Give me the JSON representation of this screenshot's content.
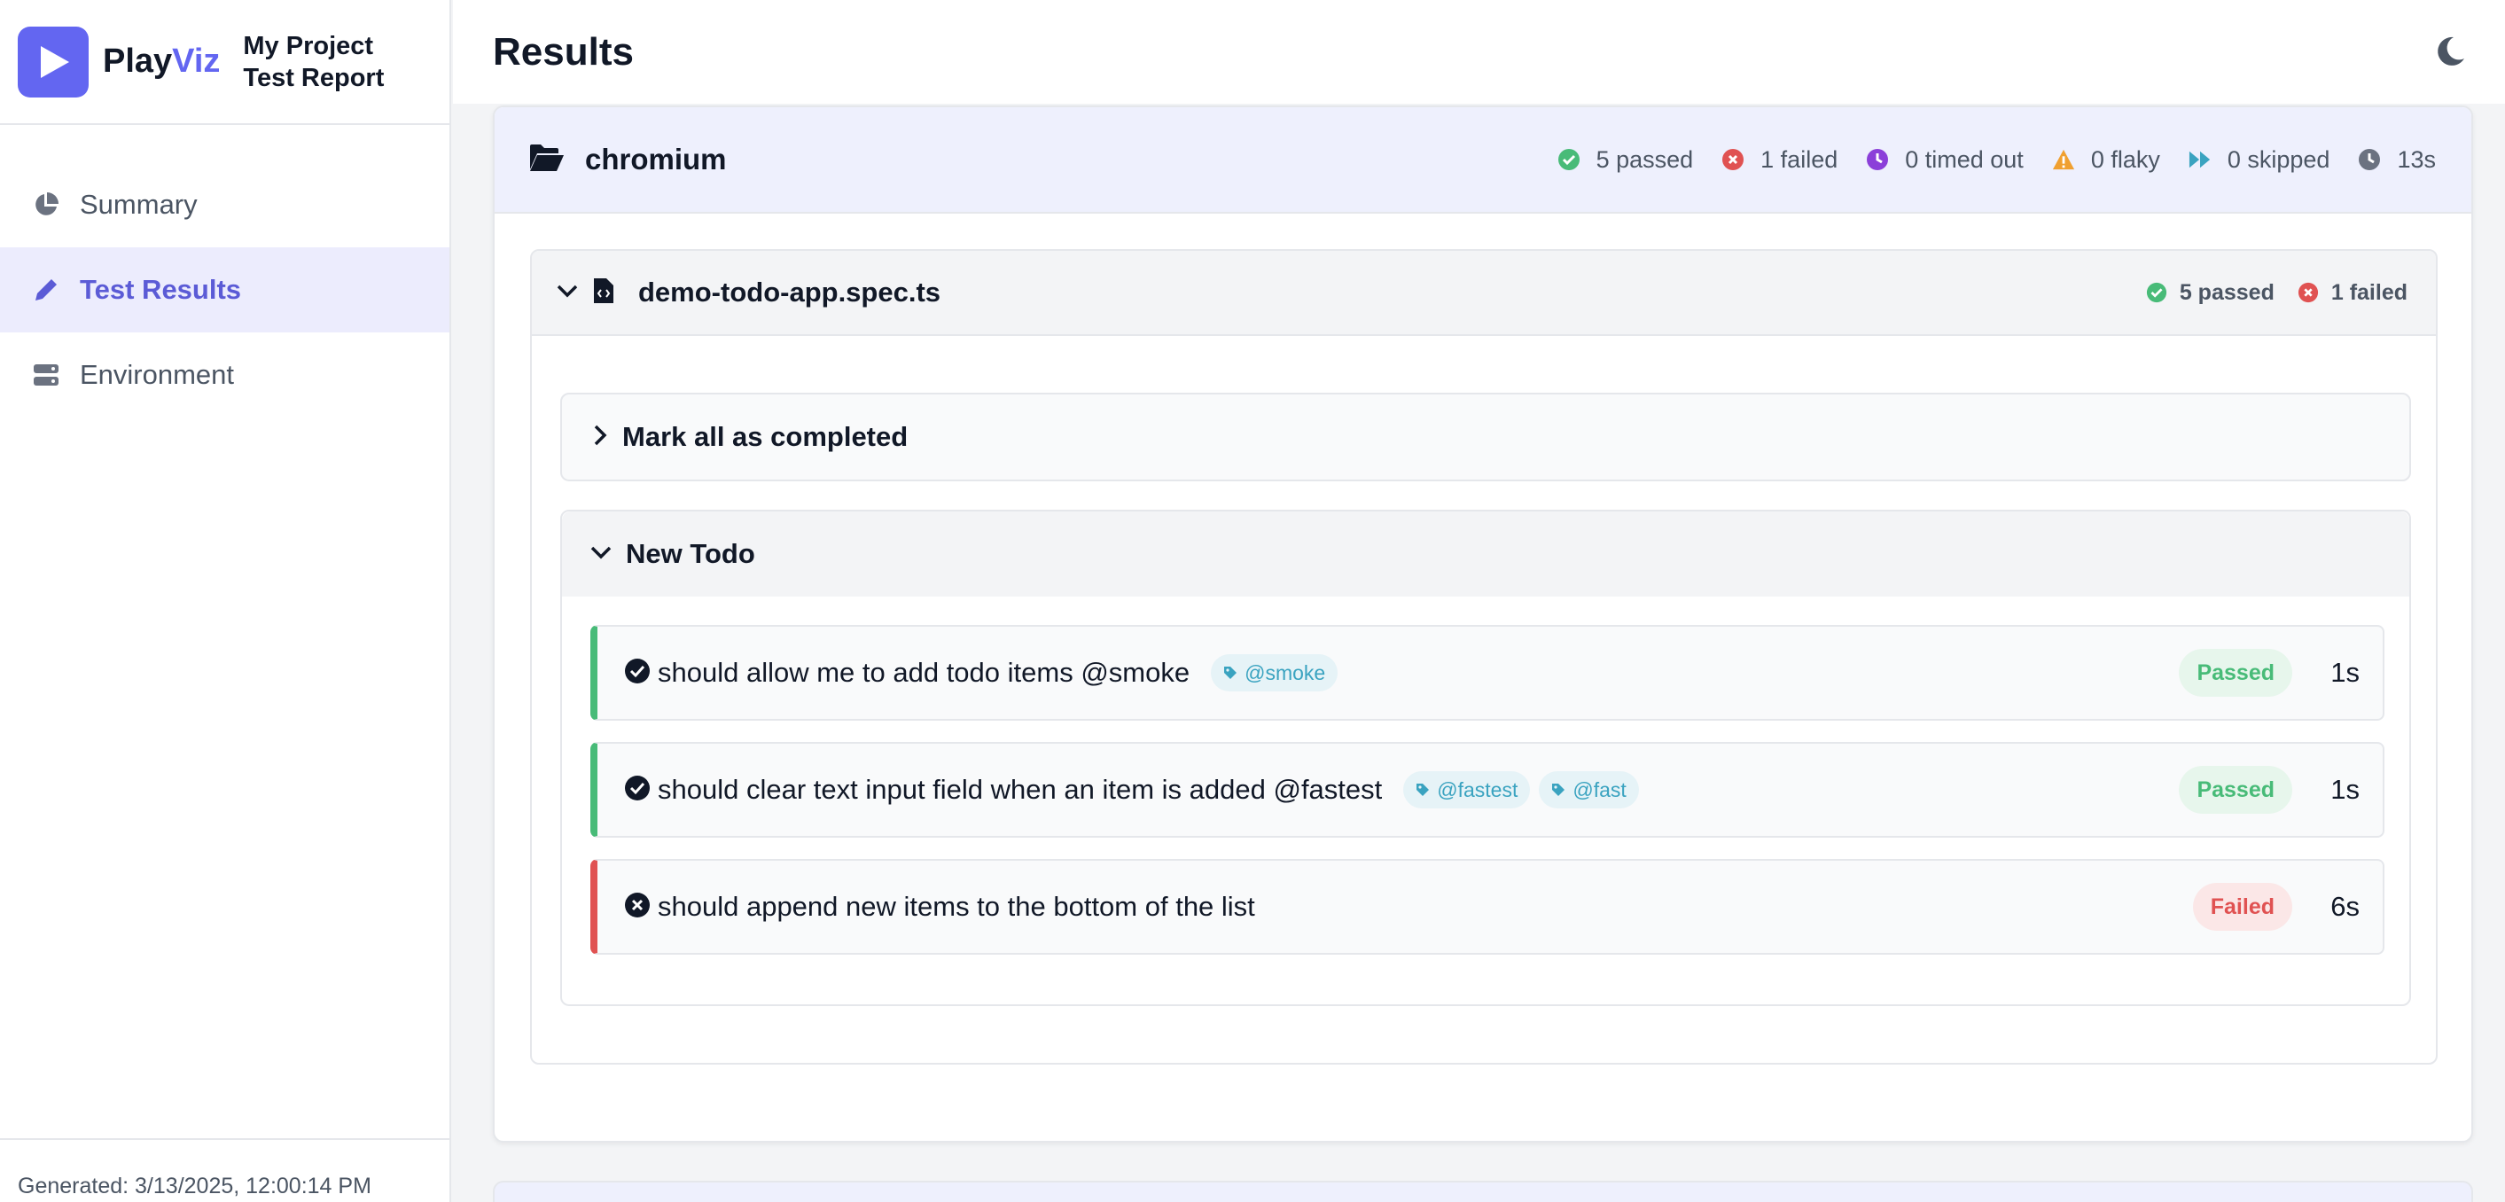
{
  "brand": {
    "name_part1": "Play",
    "name_part2": "Viz",
    "project_line1": "My Project",
    "project_line2": "Test Report"
  },
  "nav": {
    "items": [
      {
        "label": "Summary",
        "icon": "pie-chart-icon"
      },
      {
        "label": "Test Results",
        "icon": "pencil-icon",
        "active": true
      },
      {
        "label": "Environment",
        "icon": "server-icon"
      }
    ]
  },
  "footer": {
    "generated": "Generated: 3/13/2025, 12:00:14 PM"
  },
  "header": {
    "title": "Results",
    "theme_icon": "moon-icon"
  },
  "project": {
    "name": "chromium",
    "stats": {
      "passed": "5 passed",
      "failed": "1 failed",
      "timed_out": "0 timed out",
      "flaky": "0 flaky",
      "skipped": "0 skipped",
      "duration": "13s"
    }
  },
  "file": {
    "name": "demo-todo-app.spec.ts",
    "passed": "5 passed",
    "failed": "1 failed"
  },
  "suites": [
    {
      "title": "Mark all as completed",
      "expanded": false
    },
    {
      "title": "New Todo",
      "expanded": true,
      "tests": [
        {
          "title": "should allow me to add todo items @smoke",
          "tags": [
            "@smoke"
          ],
          "status": "Passed",
          "duration": "1s"
        },
        {
          "title": "should clear text input field when an item is added @fastest",
          "tags": [
            "@fastest",
            "@fast"
          ],
          "status": "Passed",
          "duration": "1s"
        },
        {
          "title": "should append new items to the bottom of the list",
          "tags": [],
          "status": "Failed",
          "duration": "6s"
        }
      ]
    }
  ],
  "colors": {
    "accent": "#6366f1",
    "passed": "#48bb78",
    "failed": "#e05252",
    "timed_out": "#8b3fd9",
    "flaky": "#f0a030",
    "skipped": "#3aa3c0"
  }
}
